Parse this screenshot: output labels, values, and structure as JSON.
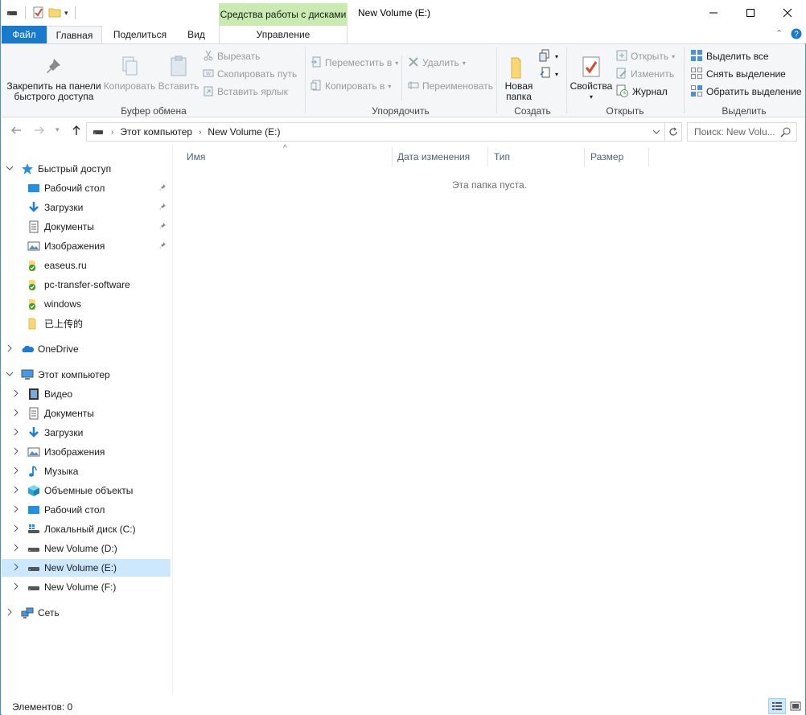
{
  "window": {
    "title": "New Volume (E:)",
    "context_tab_group": "Средства работы с дисками",
    "controls": {
      "minimize": "—",
      "maximize": "☐",
      "close": "✕"
    }
  },
  "ribbon_tabs": {
    "file": "Файл",
    "home": "Главная",
    "share": "Поделиться",
    "view": "Вид",
    "manage": "Управление"
  },
  "ribbon": {
    "clipboard": {
      "label": "Буфер обмена",
      "pin": "Закрепить на панели быстрого доступа",
      "pin_line1": "Закрепить на панели",
      "pin_line2": "быстрого доступа",
      "copy": "Копировать",
      "paste": "Вставить",
      "cut": "Вырезать",
      "copy_path": "Скопировать путь",
      "paste_shortcut": "Вставить ярлык"
    },
    "organize": {
      "label": "Упорядочить",
      "move_to": "Переместить в",
      "copy_to": "Копировать в",
      "delete": "Удалить",
      "rename": "Переименовать"
    },
    "new": {
      "label": "Создать",
      "new_folder_line1": "Новая",
      "new_folder_line2": "папка"
    },
    "open": {
      "label": "Открыть",
      "properties": "Свойства",
      "open": "Открыть",
      "edit": "Изменить",
      "history": "Журнал"
    },
    "select": {
      "label": "Выделить",
      "select_all": "Выделить все",
      "select_none": "Снять выделение",
      "invert": "Обратить выделение"
    }
  },
  "address": {
    "crumbs": [
      "Этот компьютер",
      "New Volume (E:)"
    ],
    "search_placeholder": "Поиск: New Volu..."
  },
  "nav": {
    "quick_access": {
      "label": "Быстрый доступ",
      "items": [
        {
          "label": "Рабочий стол",
          "icon": "desktop-icon",
          "pinned": true
        },
        {
          "label": "Загрузки",
          "icon": "download-icon",
          "pinned": true
        },
        {
          "label": "Документы",
          "icon": "documents-icon",
          "pinned": true
        },
        {
          "label": "Изображения",
          "icon": "pictures-icon",
          "pinned": true
        },
        {
          "label": "easeus.ru",
          "icon": "synced-folder-icon",
          "pinned": false
        },
        {
          "label": "pc-transfer-software",
          "icon": "synced-folder-icon",
          "pinned": false
        },
        {
          "label": "windows",
          "icon": "synced-folder-icon",
          "pinned": false
        },
        {
          "label": "已上传的",
          "icon": "folder-icon",
          "pinned": false
        }
      ]
    },
    "onedrive": {
      "label": "OneDrive"
    },
    "this_pc": {
      "label": "Этот компьютер",
      "items": [
        {
          "label": "Видео",
          "icon": "video-icon"
        },
        {
          "label": "Документы",
          "icon": "documents-icon"
        },
        {
          "label": "Загрузки",
          "icon": "download-icon"
        },
        {
          "label": "Изображения",
          "icon": "pictures-icon"
        },
        {
          "label": "Музыка",
          "icon": "music-icon"
        },
        {
          "label": "Объемные объекты",
          "icon": "3d-objects-icon"
        },
        {
          "label": "Рабочий стол",
          "icon": "desktop-icon"
        },
        {
          "label": "Локальный диск (C:)",
          "icon": "system-drive-icon"
        },
        {
          "label": "New Volume (D:)",
          "icon": "drive-icon"
        },
        {
          "label": "New Volume (E:)",
          "icon": "drive-icon",
          "selected": true
        },
        {
          "label": "New Volume (F:)",
          "icon": "drive-icon"
        }
      ]
    },
    "network": {
      "label": "Сеть"
    }
  },
  "content": {
    "columns": [
      "Имя",
      "Дата изменения",
      "Тип",
      "Размер"
    ],
    "empty_message": "Эта папка пуста."
  },
  "status": {
    "items_count": "Элементов: 0"
  },
  "colors": {
    "file_tab": "#1979ca",
    "context_tab": "#c9ebb2",
    "selection": "#cce8ff",
    "ribbon_bg": "#f5f6f7"
  }
}
